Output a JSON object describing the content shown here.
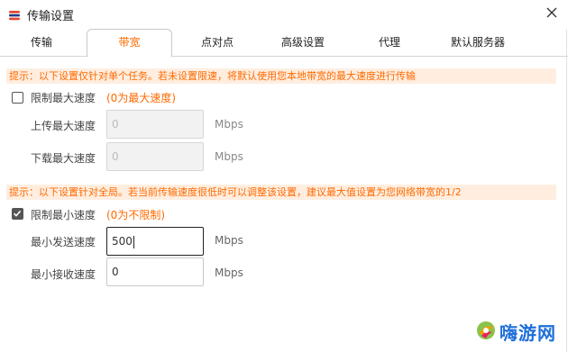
{
  "window": {
    "title": "传输设置",
    "close_icon": "close-icon"
  },
  "tabs": [
    {
      "label": "传输",
      "active": false
    },
    {
      "label": "带宽",
      "active": true
    },
    {
      "label": "点对点",
      "active": false
    },
    {
      "label": "高级设置",
      "active": false
    },
    {
      "label": "代理",
      "active": false
    },
    {
      "label": "默认服务器",
      "active": false
    }
  ],
  "max_speed": {
    "hint": "提示：以下设置仅针对单个任务。若未设置限速，将默认使用您本地带宽的最大速度进行传输",
    "checkbox_label": "限制最大速度",
    "checked": false,
    "note": "(0为最大速度)",
    "upload_label": "上传最大速度",
    "upload_value": "0",
    "download_label": "下载最大速度",
    "download_value": "0",
    "unit": "Mbps"
  },
  "min_speed": {
    "hint": "提示：以下设置针对全局。若当前传输速度很低时可以调整该设置，建议最大值设置为您网络带宽的1/2",
    "checkbox_label": "限制最小速度",
    "checked": true,
    "note": "(0为不限制)",
    "send_label": "最小发送速度",
    "send_value": "500",
    "receive_label": "最小接收速度",
    "receive_value": "0",
    "unit": "Mbps"
  },
  "watermark": {
    "text": "嗨游网"
  },
  "colors": {
    "accent": "#ff6a00",
    "hint_bg": "#ffeee0",
    "watermark": "#1e6fd9"
  }
}
